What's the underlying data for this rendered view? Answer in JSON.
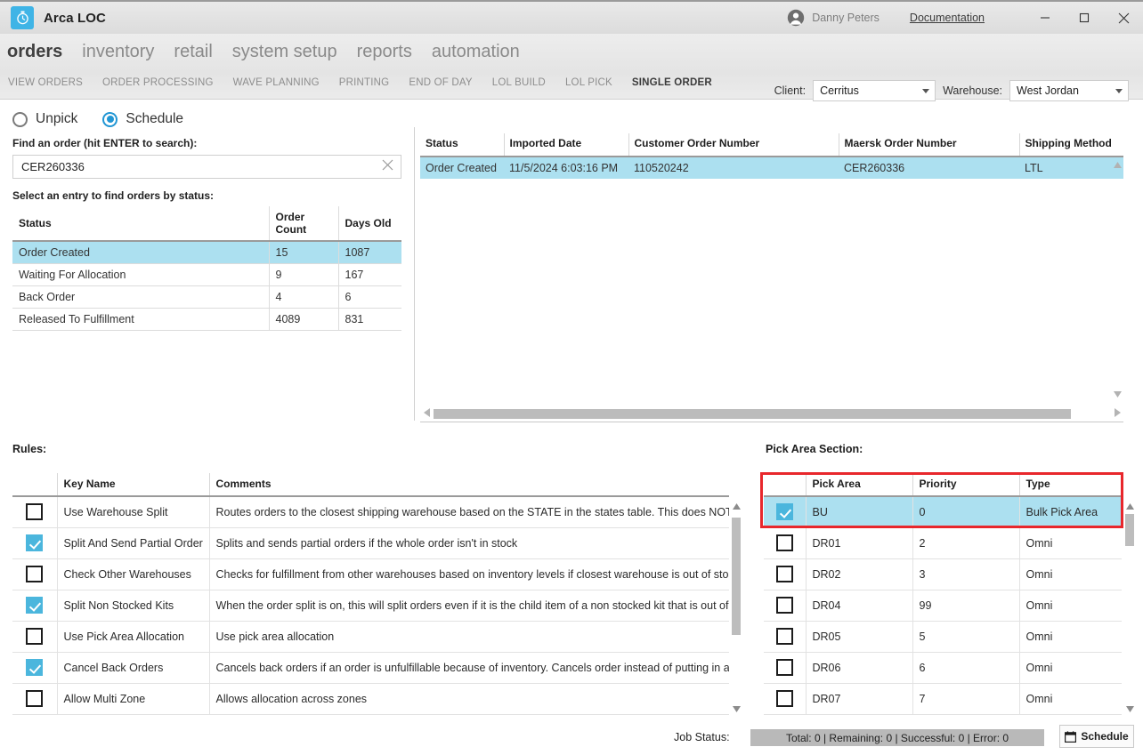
{
  "titlebar": {
    "app_name": "Arca LOC",
    "logo_icon": "stopwatch-icon",
    "user_name": "Danny Peters",
    "documentation_label": "Documentation",
    "accent_color": "#3fb4e6",
    "window_controls": {
      "minimize": "minimize-icon",
      "maximize": "maximize-icon",
      "close": "close-icon"
    }
  },
  "nav": {
    "main_tabs": [
      {
        "label": "orders",
        "active": true
      },
      {
        "label": "inventory",
        "active": false
      },
      {
        "label": "retail",
        "active": false
      },
      {
        "label": "system setup",
        "active": false
      },
      {
        "label": "reports",
        "active": false
      },
      {
        "label": "automation",
        "active": false
      }
    ],
    "sub_tabs": [
      {
        "label": "VIEW ORDERS",
        "active": false
      },
      {
        "label": "ORDER PROCESSING",
        "active": false
      },
      {
        "label": "WAVE PLANNING",
        "active": false
      },
      {
        "label": "PRINTING",
        "active": false
      },
      {
        "label": "END OF DAY",
        "active": false
      },
      {
        "label": "LOL BUILD",
        "active": false
      },
      {
        "label": "LOL PICK",
        "active": false
      },
      {
        "label": "SINGLE ORDER",
        "active": true
      }
    ]
  },
  "selectors": {
    "client_label": "Client:",
    "client_value": "Cerritus",
    "warehouse_label": "Warehouse:",
    "warehouse_value": "West Jordan"
  },
  "left_panel": {
    "mode_options": [
      {
        "label": "Unpick",
        "selected": false
      },
      {
        "label": "Schedule",
        "selected": true
      }
    ],
    "search_label": "Find an order (hit ENTER to search):",
    "search_value": "CER260336",
    "search_placeholder": "",
    "status_list_label": "Select an entry to find orders by status:",
    "status_table": {
      "columns": [
        "Status",
        "Order Count",
        "Days Old"
      ],
      "rows": [
        {
          "status": "Order Created",
          "order_count": "15",
          "days_old": "1087",
          "selected": true
        },
        {
          "status": "Waiting For Allocation",
          "order_count": "9",
          "days_old": "167",
          "selected": false
        },
        {
          "status": "Back Order",
          "order_count": "4",
          "days_old": "6",
          "selected": false
        },
        {
          "status": "Released To Fulfillment",
          "order_count": "4089",
          "days_old": "831",
          "selected": false
        }
      ]
    }
  },
  "order_grid": {
    "columns": [
      "Status",
      "Imported Date",
      "Customer Order Number",
      "Maersk Order Number",
      "Shipping Method"
    ],
    "rows": [
      {
        "status": "Order Created",
        "imported_date": "11/5/2024 6:03:16 PM",
        "customer_order_number": "110520242",
        "maersk_order_number": "CER260336",
        "shipping_method": "LTL",
        "selected": true
      }
    ]
  },
  "rules": {
    "label": "Rules:",
    "columns": [
      "",
      "Key Name",
      "Comments"
    ],
    "rows": [
      {
        "checked": false,
        "key_name": "Use Warehouse Split",
        "comments": "Routes orders to the closest shipping warehouse based on the STATE in the states table. This does NOT look at i"
      },
      {
        "checked": true,
        "key_name": "Split And Send Partial Order",
        "comments": "Splits and sends partial orders if the whole order isn't in stock"
      },
      {
        "checked": false,
        "key_name": "Check Other Warehouses",
        "comments": "Checks for fulfillment from other warehouses based on inventory levels if closest warehouse is out of stock."
      },
      {
        "checked": true,
        "key_name": "Split Non Stocked Kits",
        "comments": "When the order split is on, this will split orders even if it is the child item of a non stocked kit that is out of stocl"
      },
      {
        "checked": false,
        "key_name": "Use Pick Area Allocation",
        "comments": "Use pick area allocation"
      },
      {
        "checked": true,
        "key_name": "Cancel Back Orders",
        "comments": "Cancels back orders if an order is unfulfillable because of inventory. Cancels order instead of putting in a backo"
      },
      {
        "checked": false,
        "key_name": "Allow Multi Zone",
        "comments": "Allows allocation across zones"
      }
    ]
  },
  "pick_area": {
    "label": "Pick Area Section:",
    "highlight_color": "#e8272c",
    "columns": [
      "",
      "Pick Area",
      "Priority",
      "Type"
    ],
    "rows": [
      {
        "checked": true,
        "pick_area": "BU",
        "priority": "0",
        "type": "Bulk Pick Area",
        "selected": true
      },
      {
        "checked": false,
        "pick_area": "DR01",
        "priority": "2",
        "type": "Omni",
        "selected": false
      },
      {
        "checked": false,
        "pick_area": "DR02",
        "priority": "3",
        "type": "Omni",
        "selected": false
      },
      {
        "checked": false,
        "pick_area": "DR04",
        "priority": "99",
        "type": "Omni",
        "selected": false
      },
      {
        "checked": false,
        "pick_area": "DR05",
        "priority": "5",
        "type": "Omni",
        "selected": false
      },
      {
        "checked": false,
        "pick_area": "DR06",
        "priority": "6",
        "type": "Omni",
        "selected": false
      },
      {
        "checked": false,
        "pick_area": "DR07",
        "priority": "7",
        "type": "Omni",
        "selected": false
      }
    ]
  },
  "footer": {
    "job_status_label": "Job Status:",
    "job_status_value": "Total: 0 | Remaining: 0 | Successful: 0 | Error: 0",
    "schedule_button_label": "Schedule",
    "schedule_button_icon": "calendar-icon"
  }
}
